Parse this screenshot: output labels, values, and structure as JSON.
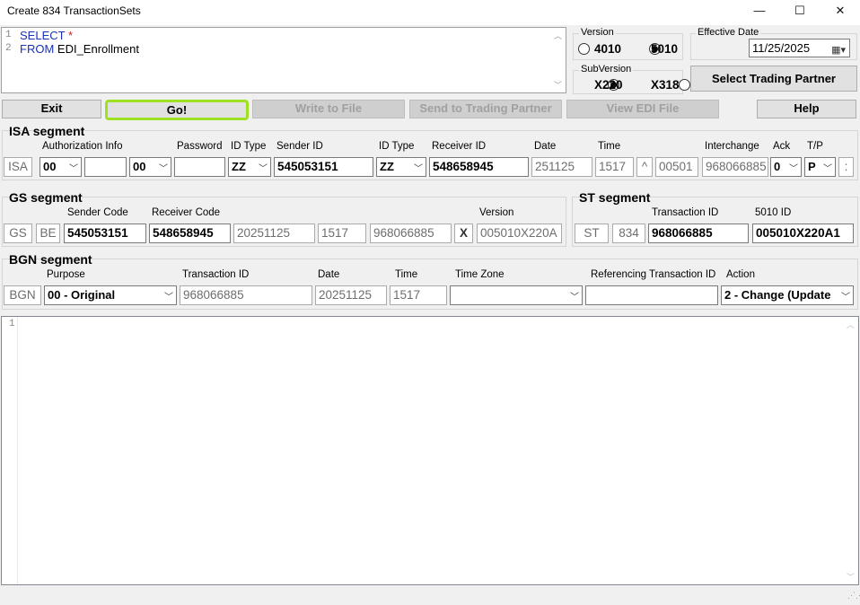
{
  "window": {
    "title": "Create 834 TransactionSets",
    "minimize": "—",
    "maximize": "☐",
    "close": "✕"
  },
  "sql": {
    "line1_no": "1",
    "line1_kw": "SELECT",
    "line1_rest": " *",
    "line2_no": "2",
    "line2_kw": "FROM",
    "line2_rest": " EDI_Enrollment"
  },
  "version": {
    "label": "Version",
    "opt1": "4010",
    "opt2": "5010",
    "selected": "5010"
  },
  "subversion": {
    "label": "SubVersion",
    "opt1": "X220",
    "opt2": "X318",
    "selected": "X220"
  },
  "effective": {
    "label": "Effective Date",
    "value": "11/25/2025"
  },
  "buttons": {
    "trading_partner": "Select Trading Partner",
    "exit": "Exit",
    "go": "Go!",
    "write": "Write to File",
    "send": "Send to Trading Partner",
    "view": "View EDI File",
    "help": "Help"
  },
  "isa": {
    "header": "ISA segment",
    "labels": {
      "auth": "Authorization Info",
      "password": "Password",
      "idtype1": "ID Type",
      "sender": "Sender ID",
      "idtype2": "ID Type",
      "receiver": "Receiver ID",
      "date": "Date",
      "time": "Time",
      "interchange": "Interchange",
      "ack": "Ack",
      "tp": "T/P"
    },
    "seg": "ISA",
    "auth_qual": "00",
    "auth_info": "",
    "pw_qual": "00",
    "password": "",
    "id_type1": "ZZ",
    "sender_id": "545053151",
    "id_type2": "ZZ",
    "receiver_id": "548658945",
    "date": "251125",
    "time": "1517",
    "repeat": "^",
    "version": "00501",
    "interchange": "968066885",
    "ack": "0",
    "tp": "P",
    "sep": ":"
  },
  "gs": {
    "header": "GS segment",
    "labels": {
      "sender": "Sender Code",
      "receiver": "Receiver Code",
      "version": "Version"
    },
    "seg": "GS",
    "func": "BE",
    "sender": "545053151",
    "receiver": "548658945",
    "date": "20251125",
    "time": "1517",
    "control": "968066885",
    "agency": "X",
    "version": "005010X220A"
  },
  "st": {
    "header": "ST segment",
    "labels": {
      "txid": "Transaction ID",
      "id5010": "5010 ID"
    },
    "seg": "ST",
    "code": "834",
    "txid": "968066885",
    "id5010": "005010X220A1"
  },
  "bgn": {
    "header": "BGN segment",
    "labels": {
      "purpose": "Purpose",
      "txid": "Transaction ID",
      "date": "Date",
      "time": "Time",
      "tz": "Time Zone",
      "ref": "Referencing Transaction ID",
      "action": "Action"
    },
    "seg": "BGN",
    "purpose": "00 - Original",
    "txid": "968066885",
    "date": "20251125",
    "time": "1517",
    "tz": "",
    "ref": "",
    "action": "2 - Change (Update"
  },
  "output": {
    "line1": "1"
  }
}
